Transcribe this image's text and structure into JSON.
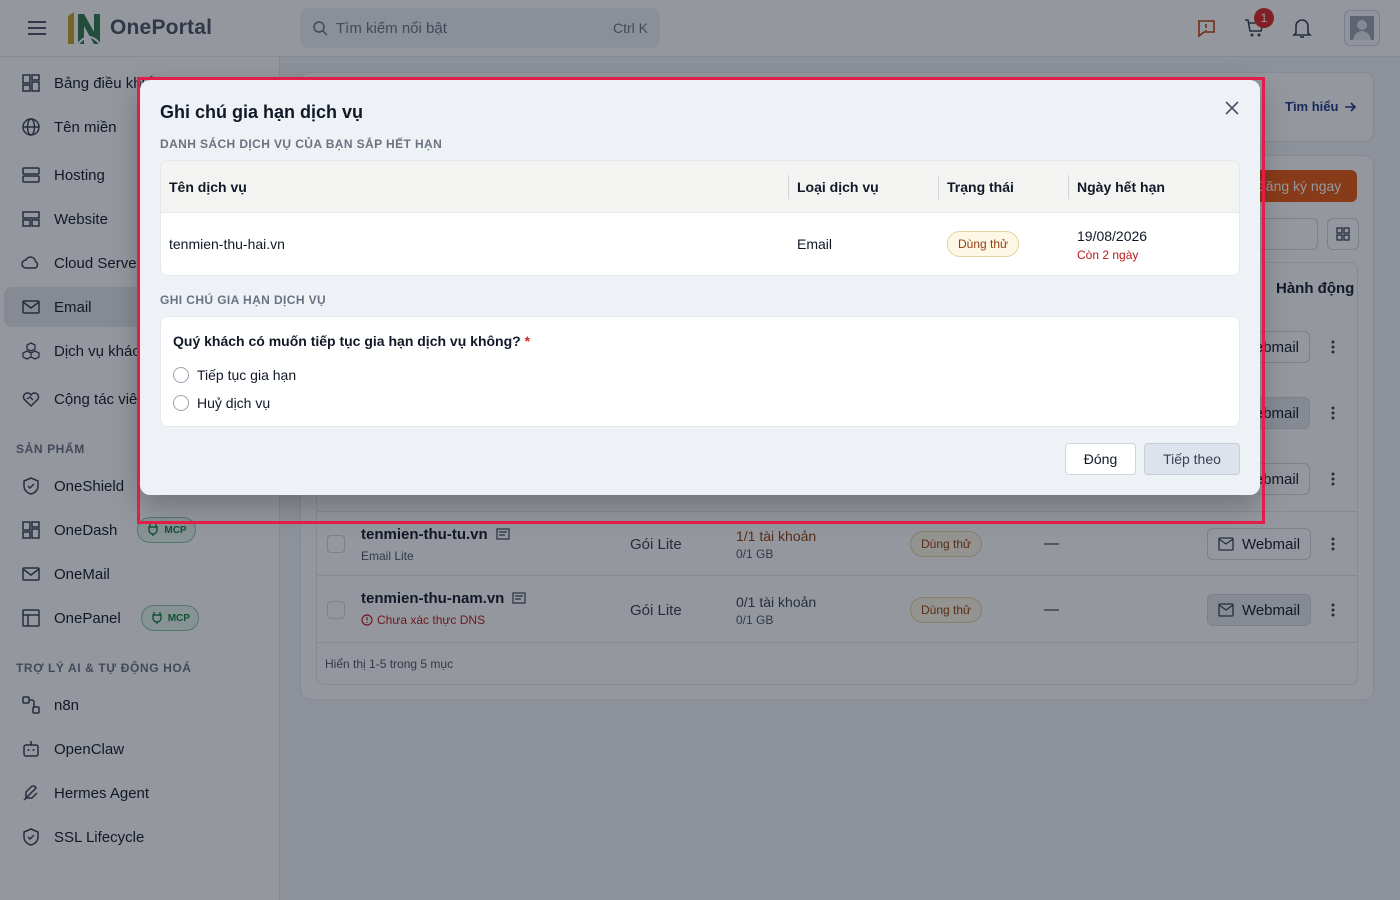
{
  "header": {
    "logo_text": "OnePortal",
    "search_placeholder": "Tìm kiếm nổi bật",
    "search_shortcut": "Ctrl K",
    "cart_count": "1"
  },
  "sidebar": {
    "items": [
      {
        "label": "Bảng điều khiển",
        "icon": "dashboard-icon"
      },
      {
        "label": "Tên miền",
        "icon": "globe-icon"
      },
      {
        "label": "Hosting",
        "icon": "server-icon"
      },
      {
        "label": "Website",
        "icon": "layout-icon"
      },
      {
        "label": "Cloud Server",
        "icon": "cloud-icon"
      },
      {
        "label": "Email",
        "icon": "mail-icon"
      },
      {
        "label": "Dịch vụ khác",
        "icon": "boxes-icon"
      },
      {
        "label": "Cộng tác viên",
        "icon": "handshake-icon"
      }
    ],
    "section_products": "SẢN PHẨM",
    "products": [
      {
        "label": "OneShield",
        "icon": "shield-icon",
        "badge": ""
      },
      {
        "label": "OneDash",
        "icon": "dashboard-icon",
        "badge": "MCP"
      },
      {
        "label": "OneMail",
        "icon": "mail-icon",
        "badge": ""
      },
      {
        "label": "OnePanel",
        "icon": "panel-icon",
        "badge": "MCP"
      }
    ],
    "section_ai": "TRỢ LÝ AI & TỰ ĐỘNG HOÁ",
    "ai_items": [
      {
        "label": "n8n",
        "icon": "workflow-icon"
      },
      {
        "label": "OpenClaw",
        "icon": "bot-icon"
      },
      {
        "label": "Hermes Agent",
        "icon": "feather-icon"
      },
      {
        "label": "SSL Lifecycle",
        "icon": "shield-check-icon"
      }
    ]
  },
  "main": {
    "learn_more": "Tìm hiểu",
    "register": "Đăng ký ngay",
    "actions_header": "Hành động",
    "bg_webmail_label": "ebmail",
    "rows": [
      {
        "domain": "tenmien-thu-tu.vn",
        "sub": "Email Lite",
        "package": "Gói Lite",
        "accounts": "1/1 tài khoản",
        "storage": "0/1 GB",
        "status": "Dùng thử",
        "expiry": "—",
        "action": "Webmail"
      },
      {
        "domain": "tenmien-thu-nam.vn",
        "sub": "Chưa xác thực DNS",
        "package": "Gói Lite",
        "accounts": "0/1 tài khoản",
        "storage": "0/1 GB",
        "status": "Dùng thử",
        "expiry": "—",
        "action": "Webmail"
      }
    ],
    "footer": "Hiển thị 1-5 trong 5 mục"
  },
  "modal": {
    "title": "Ghi chú gia hạn dịch vụ",
    "section1": "DANH SÁCH DỊCH VỤ CỦA BẠN SẮP HẾT HẠN",
    "columns": [
      "Tên dịch vụ",
      "Loại dịch vụ",
      "Trạng thái",
      "Ngày hết hạn"
    ],
    "service": {
      "name": "tenmien-thu-hai.vn",
      "type": "Email",
      "status": "Dùng thử",
      "expiry": "19/08/2026",
      "remaining": "Còn 2 ngày"
    },
    "section2": "GHI CHÚ GIA HẠN DỊCH VỤ",
    "question": "Quý khách có muốn tiếp tục gia hạn dịch vụ không?",
    "required_mark": "*",
    "options": [
      "Tiếp tục gia hạn",
      "Huỷ dịch vụ"
    ],
    "close_label": "Đóng",
    "next_label": "Tiếp theo"
  }
}
